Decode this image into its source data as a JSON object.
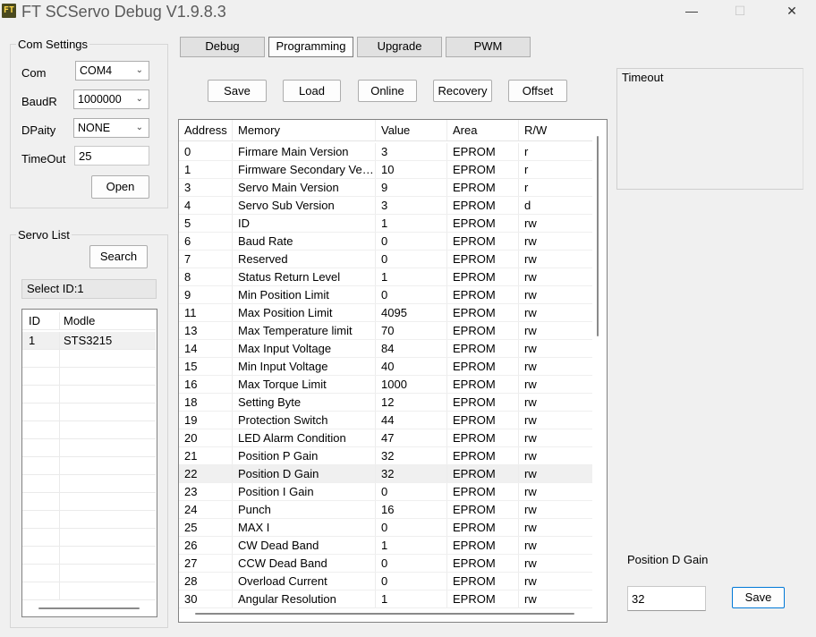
{
  "window": {
    "title": "FT SCServo Debug V1.9.8.3",
    "logo_text": "FT",
    "minimize_glyph": "—",
    "maximize_glyph": "☐",
    "close_glyph": "✕"
  },
  "com_settings": {
    "title": "Com Settings",
    "com_label": "Com",
    "com_value": "COM4",
    "baud_label": "BaudR",
    "baud_value": "1000000",
    "parity_label": "DPaity",
    "parity_value": "NONE",
    "timeout_label": "TimeOut",
    "timeout_value": "25",
    "open_label": "Open",
    "dropdown_glyph": "⌄"
  },
  "servo_list": {
    "title": "Servo List",
    "search_label": "Search",
    "selected_text": "Select ID:1",
    "columns": [
      "ID",
      "Modle"
    ],
    "rows": [
      {
        "id": "1",
        "model": "STS3215"
      }
    ]
  },
  "tabs": [
    {
      "label": "Debug",
      "active": false
    },
    {
      "label": "Programming",
      "active": true
    },
    {
      "label": "Upgrade",
      "active": false
    },
    {
      "label": "PWM",
      "active": false
    }
  ],
  "toolbar": {
    "save": "Save",
    "load": "Load",
    "online": "Online",
    "recovery": "Recovery",
    "offset": "Offset"
  },
  "memory_table": {
    "columns": [
      "Address",
      "Memory",
      "Value",
      "Area",
      "R/W"
    ],
    "rows": [
      {
        "address": "0",
        "memory": "Firmare Main Version",
        "value": "3",
        "area": "EPROM",
        "rw": "r"
      },
      {
        "address": "1",
        "memory": "Firmware Secondary Version",
        "value": "10",
        "area": "EPROM",
        "rw": "r"
      },
      {
        "address": "3",
        "memory": "Servo Main Version",
        "value": "9",
        "area": "EPROM",
        "rw": "r"
      },
      {
        "address": "4",
        "memory": "Servo Sub Version",
        "value": "3",
        "area": "EPROM",
        "rw": "d"
      },
      {
        "address": "5",
        "memory": "ID",
        "value": "1",
        "area": "EPROM",
        "rw": "rw"
      },
      {
        "address": "6",
        "memory": "Baud Rate",
        "value": "0",
        "area": "EPROM",
        "rw": "rw"
      },
      {
        "address": "7",
        "memory": "Reserved",
        "value": "0",
        "area": "EPROM",
        "rw": "rw"
      },
      {
        "address": "8",
        "memory": "Status Return Level",
        "value": "1",
        "area": "EPROM",
        "rw": "rw"
      },
      {
        "address": "9",
        "memory": "Min Position Limit",
        "value": "0",
        "area": "EPROM",
        "rw": "rw"
      },
      {
        "address": "11",
        "memory": "Max Position Limit",
        "value": "4095",
        "area": "EPROM",
        "rw": "rw"
      },
      {
        "address": "13",
        "memory": "Max Temperature limit",
        "value": "70",
        "area": "EPROM",
        "rw": "rw"
      },
      {
        "address": "14",
        "memory": "Max Input Voltage",
        "value": "84",
        "area": "EPROM",
        "rw": "rw"
      },
      {
        "address": "15",
        "memory": "Min Input Voltage",
        "value": "40",
        "area": "EPROM",
        "rw": "rw"
      },
      {
        "address": "16",
        "memory": "Max Torque Limit",
        "value": "1000",
        "area": "EPROM",
        "rw": "rw"
      },
      {
        "address": "18",
        "memory": "Setting Byte",
        "value": "12",
        "area": "EPROM",
        "rw": "rw"
      },
      {
        "address": "19",
        "memory": "Protection Switch",
        "value": "44",
        "area": "EPROM",
        "rw": "rw"
      },
      {
        "address": "20",
        "memory": "LED Alarm Condition",
        "value": "47",
        "area": "EPROM",
        "rw": "rw"
      },
      {
        "address": "21",
        "memory": "Position P Gain",
        "value": "32",
        "area": "EPROM",
        "rw": "rw"
      },
      {
        "address": "22",
        "memory": "Position D Gain",
        "value": "32",
        "area": "EPROM",
        "rw": "rw",
        "selected": true
      },
      {
        "address": "23",
        "memory": "Position I Gain",
        "value": "0",
        "area": "EPROM",
        "rw": "rw"
      },
      {
        "address": "24",
        "memory": "Punch",
        "value": "16",
        "area": "EPROM",
        "rw": "rw"
      },
      {
        "address": "25",
        "memory": "MAX I",
        "value": "0",
        "area": "EPROM",
        "rw": "rw"
      },
      {
        "address": "26",
        "memory": "CW Dead Band",
        "value": "1",
        "area": "EPROM",
        "rw": "rw"
      },
      {
        "address": "27",
        "memory": "CCW Dead Band",
        "value": "0",
        "area": "EPROM",
        "rw": "rw"
      },
      {
        "address": "28",
        "memory": "Overload Current",
        "value": "0",
        "area": "EPROM",
        "rw": "rw"
      },
      {
        "address": "30",
        "memory": "Angular Resolution",
        "value": "1",
        "area": "EPROM",
        "rw": "rw"
      }
    ]
  },
  "timeout_panel": {
    "title": "Timeout"
  },
  "editor": {
    "label": "Position D Gain",
    "value": "32",
    "save_label": "Save"
  }
}
